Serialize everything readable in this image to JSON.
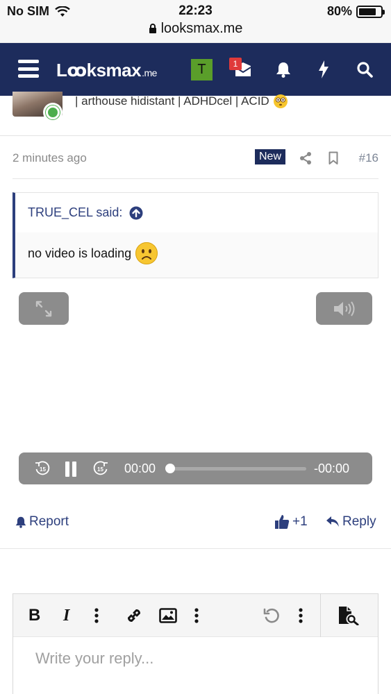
{
  "status_bar": {
    "carrier": "No SIM",
    "time": "22:23",
    "battery": "80%",
    "battery_level": 0.8,
    "url": "looksmax.me"
  },
  "nav": {
    "logo_main": "Lꝏksmax",
    "logo_suffix": ".me",
    "user_initial": "T",
    "inbox_badge": "1",
    "icons": [
      "menu-icon",
      "inbox-icon",
      "bell-icon",
      "bolt-icon",
      "search-icon"
    ]
  },
  "previous_post": {
    "signature": "| arthouse hidistant | ADHDcel | ACID"
  },
  "post": {
    "timestamp": "2 minutes ago",
    "new_label": "New",
    "number": "#16",
    "quote": {
      "author": "TRUE_CEL said:",
      "text": "no video is loading"
    },
    "video": {
      "elapsed": "00:00",
      "remaining": "-00:00",
      "progress": 0,
      "skip_back": "15",
      "skip_forward": "15"
    },
    "actions": {
      "report": "Report",
      "like": "+1",
      "reply": "Reply"
    }
  },
  "editor": {
    "placeholder": "Write your reply...",
    "bold": "B",
    "italic": "I"
  },
  "colors": {
    "navbar": "#1d2c5c",
    "accent": "#2d3f7d",
    "badge": "#e03a3a",
    "online": "#4cae4c"
  }
}
